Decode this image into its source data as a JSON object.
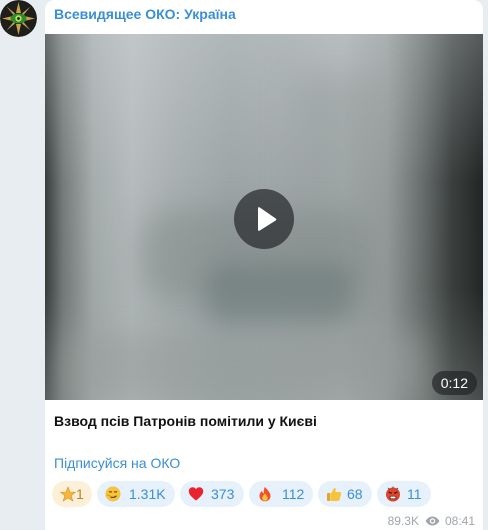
{
  "channel": {
    "name": "Всевидящее ОКО: Україна"
  },
  "video": {
    "duration": "0:12"
  },
  "post": {
    "caption": "Взвод псів Патронів помітили у Києві",
    "subscribe_link": "Підписуйся на ОКО"
  },
  "reactions": [
    {
      "icon": "star-icon",
      "count": "1"
    },
    {
      "icon": "smirk-face-icon",
      "count": "1.31K"
    },
    {
      "icon": "heart-icon",
      "count": "373"
    },
    {
      "icon": "fire-icon",
      "count": "112"
    },
    {
      "icon": "thumbs-up-icon",
      "count": "68"
    },
    {
      "icon": "angry-face-icon",
      "count": "11"
    }
  ],
  "meta": {
    "views": "89.3K",
    "time": "08:41"
  },
  "colors": {
    "accent": "#3a8fd6",
    "reaction_bg": "#e6f1fb",
    "chat_bg": "#e8edf1"
  }
}
